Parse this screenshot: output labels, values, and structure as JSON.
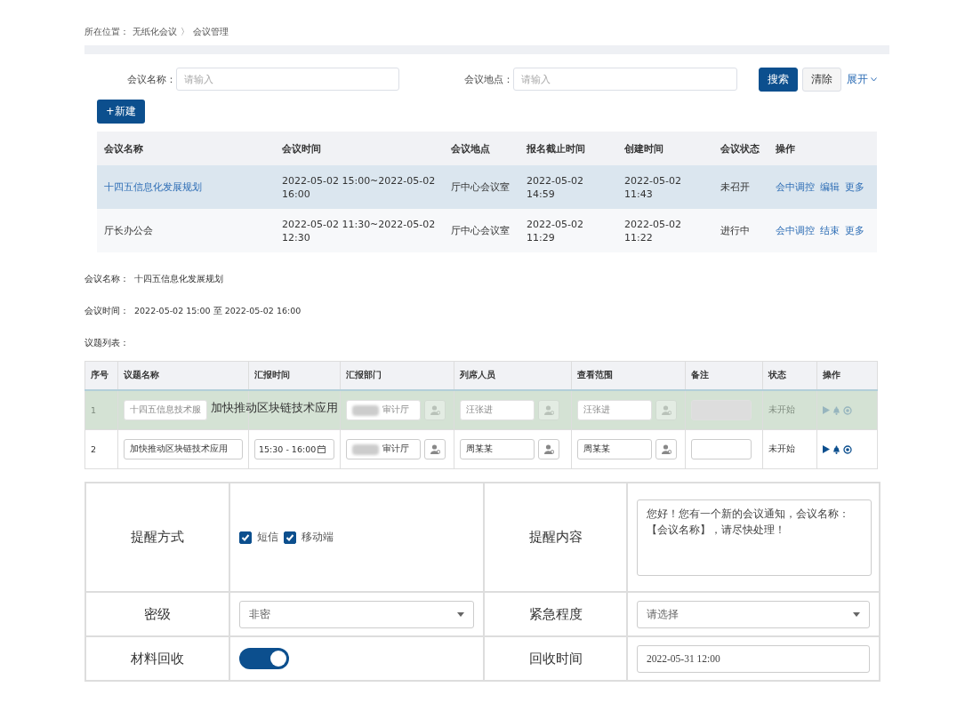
{
  "breadcrumb": {
    "label": "所在位置：",
    "separator": "〉",
    "items": [
      {
        "text": "无纸化会议"
      },
      {
        "text": "会议管理"
      }
    ]
  },
  "search": {
    "fields": [
      {
        "label": "会议名称：",
        "placeholder": "请输入"
      },
      {
        "label": "会议地点：",
        "placeholder": "请输入"
      }
    ],
    "buttons": [
      {
        "text": "搜索",
        "kind": "primary"
      },
      {
        "text": "清除",
        "kind": "default"
      }
    ],
    "expand": {
      "text": "展开",
      "expanded": false
    }
  },
  "new_button": "+新建",
  "meetings": {
    "columns": [
      "会议名称",
      "会议时间",
      "会议地点",
      "报名截止时间",
      "创建时间",
      "会议状态",
      "操作"
    ],
    "rows": [
      {
        "name": "十四五信息化发展规划",
        "time": "2022-05-02 15:00~2022-05-02 16:00",
        "place": "厅中心会议室",
        "deadline": "2022-05-02 14:59",
        "created": "2022-05-02 11:43",
        "status": "未召开",
        "actions": [
          "会中调控",
          "编辑",
          "更多"
        ],
        "selected": true
      },
      {
        "name": "厅长办公会",
        "time": "2022-05-02 11:30~2022-05-02 12:30",
        "place": "厅中心会议室",
        "deadline": "2022-05-02 11:29",
        "created": "2022-05-02 11:22",
        "status": "进行中",
        "actions": [
          "会中调控",
          "结束",
          "更多"
        ],
        "selected": false
      }
    ]
  },
  "details": {
    "fields": [
      {
        "label": "会议名称：",
        "value": "十四五信息化发展规划"
      },
      {
        "label": "会议时间：",
        "value": "2022-05-02 15:00 至 2022-05-02 16:00"
      }
    ],
    "list_label": "议题列表："
  },
  "topics": {
    "columns": [
      "序号",
      "议题名称",
      "汇报时间",
      "汇报部门",
      "列席人员",
      "查看范围",
      "备注",
      "状态",
      "操作"
    ],
    "rows": [
      {
        "index": "1",
        "name": "十四五信息技术服",
        "drag_title": "加快推动区块链技术应用",
        "dept": "审计厅",
        "attendees": "汪张进",
        "scope": "汪张进",
        "status": "未开始",
        "dragging": true
      },
      {
        "index": "2",
        "name": "加快推动区块链技术应用",
        "time": "15:30 - 16:00",
        "dept": "审计厅",
        "attendees": "周某某",
        "scope": "周某某",
        "status": "未开始",
        "dragging": false
      }
    ]
  },
  "form": {
    "rows": [
      {
        "cells": [
          {
            "label": "提醒方式",
            "kind": "checks",
            "options": [
              {
                "label": "短信",
                "checked": true
              },
              {
                "label": "移动端",
                "checked": true
              }
            ]
          },
          {
            "label": "提醒内容",
            "kind": "textarea",
            "value": "您好！您有一个新的会议通知，会议名称：【会议名称】，请尽快处理！"
          }
        ]
      },
      {
        "cells": [
          {
            "label": "密级",
            "kind": "select",
            "value": "非密"
          },
          {
            "label": "紧急程度",
            "kind": "select",
            "placeholder": "请选择"
          }
        ]
      },
      {
        "cells": [
          {
            "label": "材料回收",
            "kind": "toggle",
            "on": true
          },
          {
            "label": "回收时间",
            "kind": "input",
            "value": "2022-05-31 12:00"
          }
        ]
      }
    ]
  }
}
